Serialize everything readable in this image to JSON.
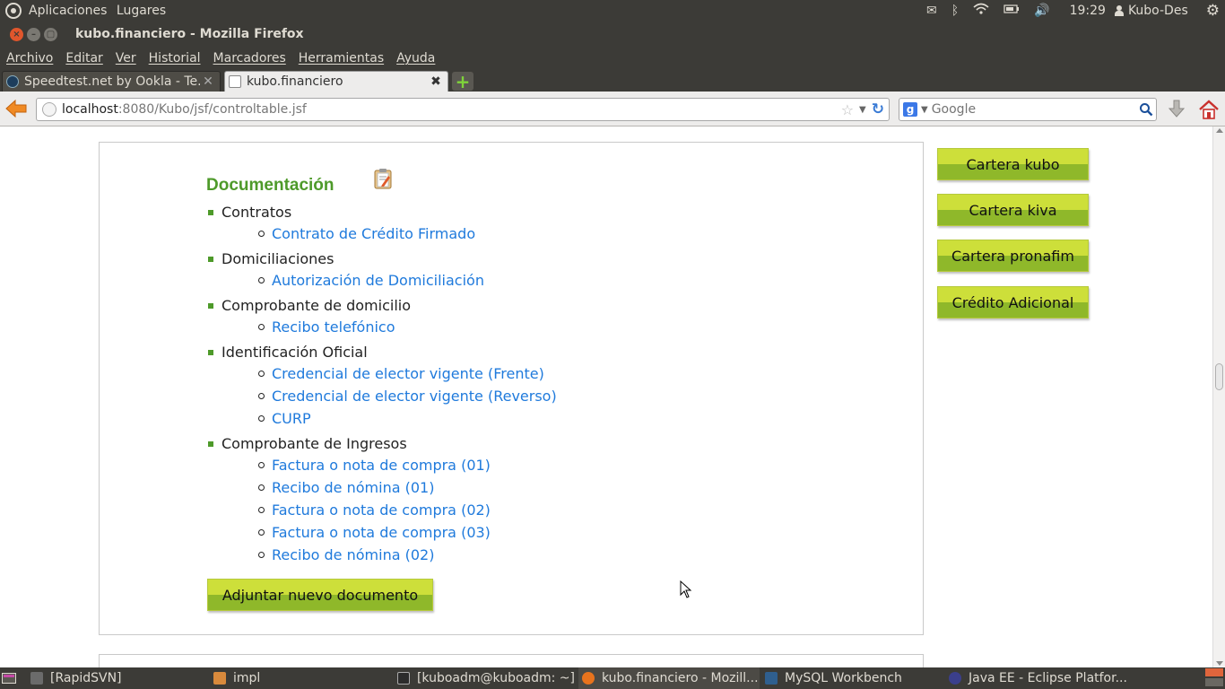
{
  "top_panel": {
    "applications": "Aplicaciones",
    "places": "Lugares",
    "clock": "19:29",
    "user": "Kubo-Des"
  },
  "window": {
    "title": "kubo.financiero - Mozilla Firefox"
  },
  "menubar": {
    "items": [
      "Archivo",
      "Editar",
      "Ver",
      "Historial",
      "Marcadores",
      "Herramientas",
      "Ayuda"
    ]
  },
  "tabs": [
    {
      "label": "Speedtest.net by Ookla - Te..."
    },
    {
      "label": "kubo.financiero"
    }
  ],
  "navbar": {
    "url_host": "localhost",
    "url_rest": ":8080/Kubo/jsf/controltable.jsf",
    "search_placeholder": "Google",
    "search_engine_icon": "google-g"
  },
  "content": {
    "section_title": "Documentación",
    "categories": [
      {
        "label": "Contratos",
        "docs": [
          "Contrato de Crédito Firmado"
        ]
      },
      {
        "label": "Domiciliaciones",
        "docs": [
          "Autorización de Domiciliación"
        ]
      },
      {
        "label": "Comprobante de domicilio",
        "docs": [
          "Recibo telefónico"
        ]
      },
      {
        "label": "Identificación Oficial",
        "docs": [
          "Credencial de elector vigente (Frente)",
          "Credencial de elector vigente (Reverso)",
          "CURP"
        ]
      },
      {
        "label": "Comprobante de Ingresos",
        "docs": [
          "Factura o nota de compra (01)",
          "Recibo de nómina (01)",
          "Factura o nota de compra (02)",
          "Factura o nota de compra (03)",
          "Recibo de nómina (02)"
        ]
      }
    ],
    "attach_button": "Adjuntar nuevo documento",
    "side_buttons": [
      "Cartera kubo",
      "Cartera kiva",
      "Cartera pronafim",
      "Crédito Adicional"
    ]
  },
  "taskbar": {
    "items": [
      {
        "label": "[RapidSVN]",
        "icon": "rapidsvn-icon"
      },
      {
        "label": "impl",
        "icon": "folder-icon"
      },
      {
        "label": "[kuboadm@kuboadm: ~]",
        "icon": "terminal-icon"
      },
      {
        "label": "kubo.financiero - Mozill...",
        "icon": "firefox-icon"
      },
      {
        "label": "MySQL Workbench",
        "icon": "mysql-workbench-icon"
      },
      {
        "label": "Java EE - Eclipse Platfor...",
        "icon": "eclipse-icon"
      }
    ]
  },
  "colors": {
    "section_title": "#4e9a2a",
    "link": "#1f7adc",
    "button_top": "#cddf3a",
    "button_bottom": "#8fb82a",
    "panel": "#3c3b37"
  }
}
